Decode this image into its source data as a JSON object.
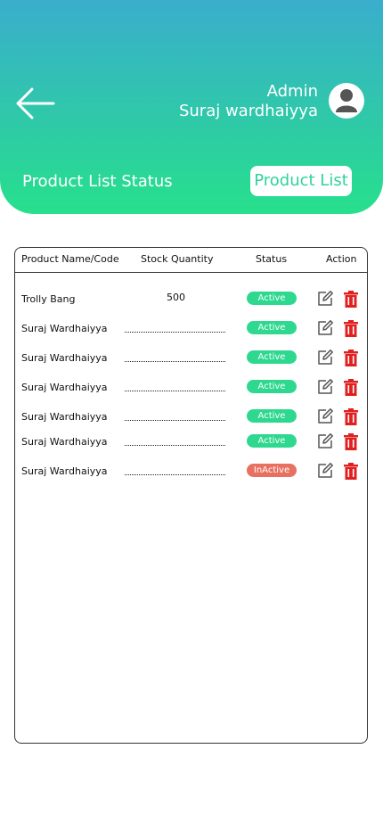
{
  "header": {
    "role": "Admin",
    "user_name": "Suraj wardhaiyya",
    "page_title": "Product List Status",
    "product_list_button": "Product List",
    "back_icon": "arrow-left-icon",
    "avatar_icon": "user-avatar-icon"
  },
  "table": {
    "columns": [
      "Product Name/Code",
      "Stock Quantity",
      "Status",
      "Action"
    ],
    "rows": [
      {
        "name": "Trolly Bang",
        "quantity": "500",
        "status": "Active"
      },
      {
        "name": "Suraj Wardhaiyya",
        "quantity": "",
        "status": "Active"
      },
      {
        "name": "Suraj Wardhaiyya",
        "quantity": "",
        "status": "Active"
      },
      {
        "name": "Suraj Wardhaiyya",
        "quantity": "",
        "status": "Active"
      },
      {
        "name": "Suraj Wardhaiyya",
        "quantity": "",
        "status": "Active"
      },
      {
        "name": "Suraj Wardhaiyya",
        "quantity": "",
        "status": "Active"
      },
      {
        "name": "Suraj Wardhaiyya",
        "quantity": "",
        "status": "InActive"
      }
    ]
  },
  "colors": {
    "active": "#2ed88f",
    "inactive": "#e87060",
    "delete": "#e02020",
    "edit": "#555555"
  },
  "icons": {
    "edit": "edit-pencil-icon",
    "delete": "trash-icon"
  }
}
